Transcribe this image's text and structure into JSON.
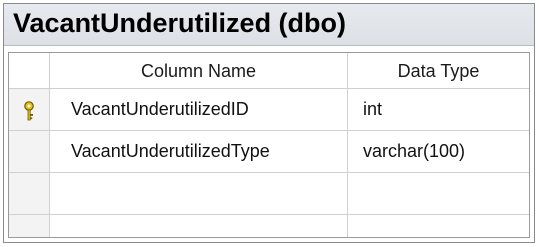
{
  "table": {
    "title": "VacantUnderutilized (dbo)",
    "columns": {
      "name_header": "Column Name",
      "type_header": "Data Type"
    },
    "rows": [
      {
        "name": "VacantUnderutilizedID",
        "type": "int",
        "primary_key": true,
        "icon": "key-icon"
      },
      {
        "name": "VacantUnderutilizedType",
        "type": "varchar(100)",
        "primary_key": false
      },
      {
        "name": "",
        "type": "",
        "primary_key": false
      }
    ]
  },
  "colors": {
    "title_bar": "#dde1e6",
    "key_icon": "#c9a400",
    "grid_lines": "#d0d0d0"
  }
}
